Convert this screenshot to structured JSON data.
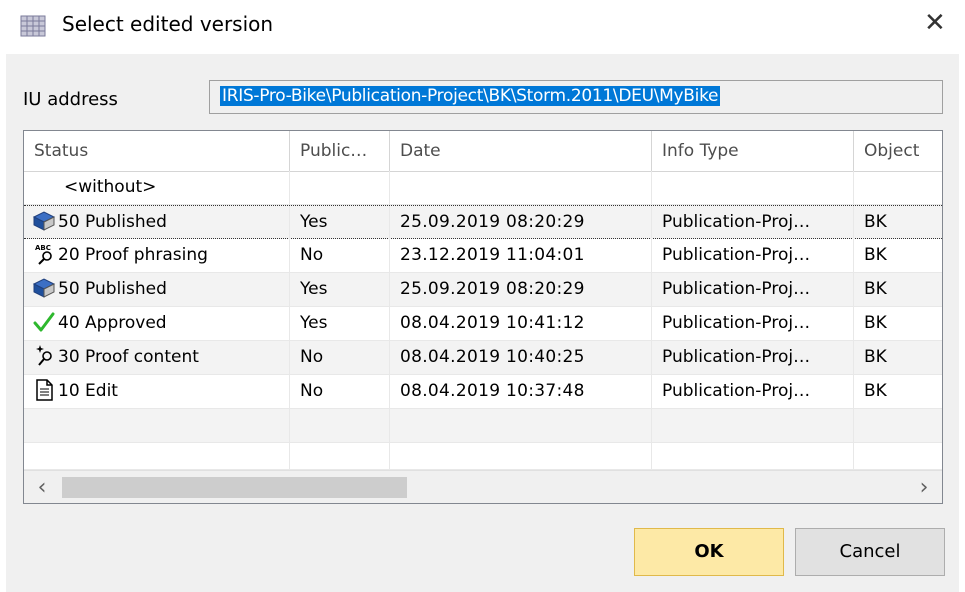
{
  "window": {
    "title": "Select edited version",
    "close_glyph": "✕"
  },
  "iu_address": {
    "label": "IU address",
    "value": "IRIS-Pro-Bike\\Publication-Project\\BK\\Storm.2011\\DEU\\MyBike"
  },
  "grid": {
    "columns": [
      "Status",
      "Public…",
      "Date",
      "Info Type",
      "Object"
    ],
    "rows": [
      {
        "status": "<without>",
        "icon": "none",
        "published": "",
        "date": "",
        "info_type": "",
        "object": ""
      },
      {
        "status": "50 Published",
        "icon": "book-icon",
        "published": "Yes",
        "date": "25.09.2019  08:20:29",
        "info_type": "Publication-Proj…",
        "object": "BK"
      },
      {
        "status": "20 Proof phrasing",
        "icon": "spell-check-icon",
        "published": "No",
        "date": "23.12.2019  11:04:01",
        "info_type": "Publication-Proj…",
        "object": "BK"
      },
      {
        "status": "50 Published",
        "icon": "book-icon",
        "published": "Yes",
        "date": "25.09.2019  08:20:29",
        "info_type": "Publication-Proj…",
        "object": "BK"
      },
      {
        "status": "40 Approved",
        "icon": "checkmark-icon",
        "published": "Yes",
        "date": "08.04.2019  10:41:12",
        "info_type": "Publication-Proj…",
        "object": "BK"
      },
      {
        "status": "30 Proof content",
        "icon": "magnifier-sparkle-icon",
        "published": "No",
        "date": "08.04.2019  10:40:25",
        "info_type": "Publication-Proj…",
        "object": "BK"
      },
      {
        "status": "10 Edit",
        "icon": "document-icon",
        "published": "No",
        "date": "08.04.2019  10:37:48",
        "info_type": "Publication-Proj…",
        "object": "BK"
      }
    ]
  },
  "scrollbar": {
    "left_glyph": "‹",
    "right_glyph": "›"
  },
  "buttons": {
    "ok": "OK",
    "cancel": "Cancel"
  },
  "colors": {
    "selection": "#0078d7",
    "ok_button": "#fde9a6",
    "ok_border": "#e0b94a",
    "approved_check": "#2eb82e",
    "book_blue": "#1f4f9c"
  }
}
